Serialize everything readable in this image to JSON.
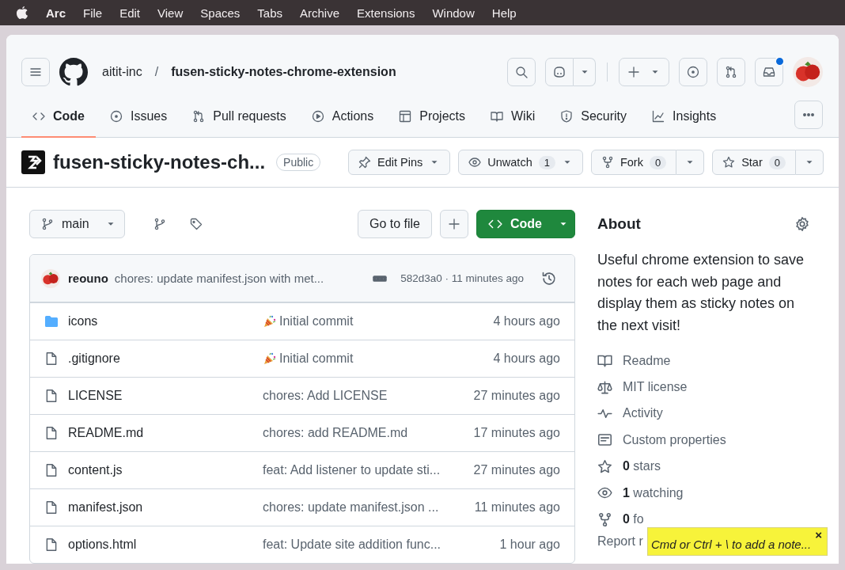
{
  "menubar": {
    "items": [
      {
        "label": "Arc",
        "kind": "app"
      },
      {
        "label": "File",
        "kind": "menu"
      },
      {
        "label": "Edit",
        "kind": "menu"
      },
      {
        "label": "View",
        "kind": "menu"
      },
      {
        "label": "Spaces",
        "kind": "menu"
      },
      {
        "label": "Tabs",
        "kind": "menu"
      },
      {
        "label": "Archive",
        "kind": "menu"
      },
      {
        "label": "Extensions",
        "kind": "menu"
      },
      {
        "label": "Window",
        "kind": "menu"
      },
      {
        "label": "Help",
        "kind": "menu"
      }
    ]
  },
  "header": {
    "owner": "aitit-inc",
    "separator": "/",
    "repo": "fusen-sticky-notes-chrome-extension",
    "inbox_unread": true
  },
  "tabs": [
    {
      "label": "Code",
      "kind": "code",
      "selected": true
    },
    {
      "label": "Issues",
      "kind": "issues",
      "selected": false
    },
    {
      "label": "Pull requests",
      "kind": "pulls",
      "selected": false
    },
    {
      "label": "Actions",
      "kind": "actions",
      "selected": false
    },
    {
      "label": "Projects",
      "kind": "projects",
      "selected": false
    },
    {
      "label": "Wiki",
      "kind": "wiki",
      "selected": false
    },
    {
      "label": "Security",
      "kind": "security",
      "selected": false
    },
    {
      "label": "Insights",
      "kind": "insights",
      "selected": false
    }
  ],
  "repo_title": {
    "name": "fusen-sticky-notes-ch...",
    "visibility": "Public",
    "actions": [
      {
        "label": "Edit Pins",
        "kind": "pin"
      },
      {
        "label": "Unwatch",
        "kind": "watch",
        "count": "1"
      },
      {
        "label": "Fork",
        "kind": "fork",
        "count": "0"
      },
      {
        "label": "Star",
        "kind": "star",
        "count": "0"
      }
    ]
  },
  "toolbar": {
    "branch": "main",
    "go_to_file": "Go to file",
    "code_button": "Code"
  },
  "commit": {
    "author": "reouno",
    "message": "chores: update manifest.json with met...",
    "hash_time": "582d3a0 · 11 minutes ago"
  },
  "files": [
    {
      "name": "icons",
      "kind": "folder",
      "message": "Initial commit",
      "celebrate": true,
      "time": "4 hours ago"
    },
    {
      "name": ".gitignore",
      "kind": "file",
      "message": "Initial commit",
      "celebrate": true,
      "time": "4 hours ago"
    },
    {
      "name": "LICENSE",
      "kind": "file",
      "message": "chores: Add LICENSE",
      "celebrate": false,
      "time": "27 minutes ago"
    },
    {
      "name": "README.md",
      "kind": "file",
      "message": "chores: add README.md",
      "celebrate": false,
      "time": "17 minutes ago"
    },
    {
      "name": "content.js",
      "kind": "file",
      "message": "feat: Add listener to update sti...",
      "celebrate": false,
      "time": "27 minutes ago"
    },
    {
      "name": "manifest.json",
      "kind": "file",
      "message": "chores: update manifest.json ...",
      "celebrate": false,
      "time": "11 minutes ago"
    },
    {
      "name": "options.html",
      "kind": "file",
      "message": "feat: Update site addition func...",
      "celebrate": false,
      "time": "1 hour ago"
    }
  ],
  "about": {
    "title": "About",
    "description": "Useful chrome extension to save notes for each web page and display them as sticky notes on the next visit!",
    "links": [
      {
        "label": "Readme",
        "kind": "readme"
      },
      {
        "label": "MIT license",
        "kind": "license"
      },
      {
        "label": "Activity",
        "kind": "activity"
      },
      {
        "label": "Custom properties",
        "kind": "properties"
      },
      {
        "label": "**0** stars",
        "kind": "stars"
      },
      {
        "label": "**1** watching",
        "kind": "watching"
      },
      {
        "label": "**0** fo",
        "kind": "forks"
      }
    ],
    "report": "Report r"
  },
  "sticky_note": {
    "text": "Cmd or Ctrl + \\ to add a note...",
    "close": "×"
  }
}
